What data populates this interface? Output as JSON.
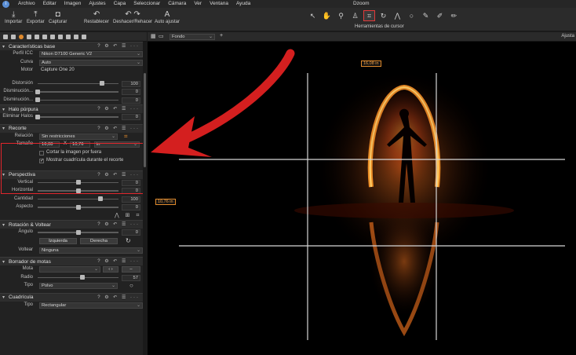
{
  "menubar": {
    "items": [
      "Archivo",
      "Editar",
      "Imagen",
      "Ajustes",
      "Capa",
      "Seleccionar",
      "Cámara",
      "Ver",
      "Ventana",
      "Ayuda"
    ],
    "title": "Dzoom"
  },
  "toolbar": {
    "import": "Importar",
    "export": "Exportar",
    "capture": "Capturar",
    "reset": "Restablecer",
    "undo_redo": "Deshacer/Rehacer",
    "auto": "Auto ajustar",
    "cursor_tools_caption": "Herramientas de cursor"
  },
  "panel": {
    "base": {
      "title": "Características base",
      "icc_label": "Perfil ICC",
      "icc_value": "Nikon D7100 Generic V2",
      "curve_label": "Curva",
      "curve_value": "Auto",
      "engine_label": "Motor",
      "engine_value": "Capture One 20"
    },
    "lens": {
      "distortion_label": "Distorsión",
      "distortion_value": "100",
      "light_falloff_label": "Disminución...",
      "light_falloff_value": "0",
      "sharpness_falloff_label": "Disminución...",
      "sharpness_falloff_value": "0"
    },
    "fringe": {
      "title": "Halo púrpura",
      "remove_label": "Eliminar Halos",
      "remove_value": "0"
    },
    "crop": {
      "title": "Recorte",
      "ratio_label": "Relación",
      "ratio_value": "Sin restricciones",
      "size_label": "Tamaño",
      "width": "16,08",
      "times": "X",
      "height": "10,76",
      "unit": "in",
      "outside_label": "Cortar la imagen por fuera",
      "grid_label": "Mostrar cuadrícula durante el recorte",
      "grid_checked": "✓"
    },
    "perspective": {
      "title": "Perspectiva",
      "vertical_label": "Vertical",
      "vertical_value": "0",
      "horizontal_label": "Horizontal",
      "horizontal_value": "0",
      "amount_label": "Cantidad",
      "amount_value": "100",
      "aspect_label": "Aspecto",
      "aspect_value": "0"
    },
    "rotation": {
      "title": "Rotación & Voltear",
      "angle_label": "Ángulo",
      "angle_value": "0",
      "left_btn": "Izquierda",
      "right_btn": "Derecha",
      "flip_label": "Voltear",
      "flip_value": "Ninguna"
    },
    "spot": {
      "title": "Borrador de motas",
      "spot_label": "Mota",
      "radius_label": "Radio",
      "radius_value": "57",
      "type_label": "Tipo",
      "type_value": "Polvo"
    },
    "grid": {
      "title": "Cuadrícula",
      "type_label": "Tipo",
      "type_value": "Rectangular"
    }
  },
  "viewer": {
    "background": "Fondo",
    "right_label": "Ajusta",
    "width_label": "16,08 in",
    "height_label": "10,76 in"
  },
  "colors": {
    "accent": "#e08a2c",
    "highlight": "#e1262c"
  }
}
